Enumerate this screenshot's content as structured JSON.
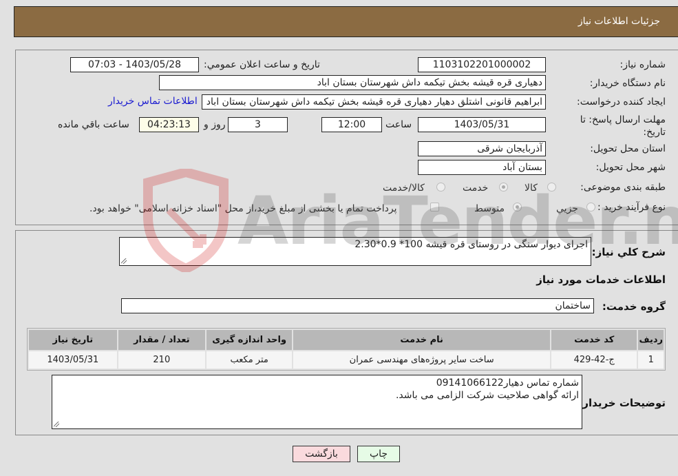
{
  "header": {
    "title": "جزئیات اطلاعات نیاز"
  },
  "details": {
    "need_number": {
      "label": "شماره نیاز:",
      "value": "1103102201000002"
    },
    "announce_datetime": {
      "label": "تاریخ و ساعت اعلان عمومي:",
      "value": "1403/05/28 - 07:03"
    },
    "buyer_org": {
      "label": "نام دستگاه خریدار:",
      "value": "دهیاری قره قیشه بخش تیکمه داش شهرستان بستان اباد"
    },
    "requester": {
      "label": "ایجاد کننده درخواست:",
      "value": "ابراهیم قانونی اشتلق دهیار دهیاری قره قیشه بخش تیکمه داش شهرستان بستان اباد",
      "contact_link": "اطلاعات تماس خریدار"
    },
    "deadline": {
      "label": "مهلت ارسال پاسخ: تا تاریخ:",
      "date": "1403/05/31",
      "time_label": "ساعت",
      "time": "12:00",
      "days": "3",
      "days_label": "روز و",
      "remaining": "04:23:13",
      "remaining_label": "ساعت باقي مانده"
    },
    "province": {
      "label": "استان محل تحویل:",
      "value": "آذربایجان شرقی"
    },
    "city": {
      "label": "شهر محل تحویل:",
      "value": "بستان آباد"
    },
    "category": {
      "label": "طبقه بندی موضوعی:",
      "options": [
        "کالا",
        "خدمت",
        "کالا/خدمت"
      ],
      "selected": "خدمت"
    },
    "purchase_type": {
      "label": "نوع فرآیند خرید :",
      "options": [
        "جزيي",
        "متوسط"
      ],
      "selected": "متوسط",
      "treasury_checkbox_label": "پرداخت تمام یا بخشی از مبلغ خرید،از محل \"اسناد خزانه اسلامی\" خواهد بود."
    }
  },
  "summary": {
    "label": "شرح كلي نياز:",
    "value": "اجرای دیوار سنگی در روستای قره قیشه 100* 0.9*2.30"
  },
  "services_section": {
    "title": "اطلاعات خدمات مورد نیاز",
    "group_label": "گروه خدمت:",
    "group_value": "ساختمان",
    "table": {
      "headers": [
        "ردیف",
        "کد خدمت",
        "نام خدمت",
        "واحد اندازه گیری",
        "تعداد / مقدار",
        "تاریخ نیاز"
      ],
      "rows": [
        [
          "1",
          "ج-42-429",
          "ساخت سایر پروژه‌های مهندسی عمران",
          "متر مکعب",
          "210",
          "1403/05/31"
        ]
      ]
    }
  },
  "buyer_notes": {
    "label": "توضیحات خریدار:",
    "lines": [
      "شماره تماس دهیار09141066122",
      "ارائه گواهی صلاحیت شرکت الزامی می باشد."
    ]
  },
  "buttons": {
    "print": "چاپ",
    "back": "بازگشت"
  },
  "watermark": {
    "text": "AriaTender.neT"
  }
}
